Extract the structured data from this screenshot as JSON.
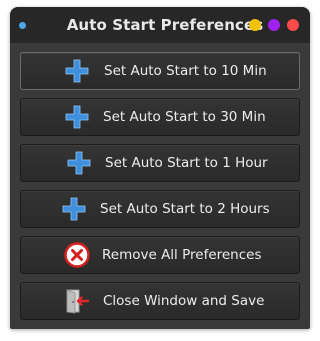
{
  "window": {
    "title": "Auto Start Preferences",
    "controls": {
      "minimize_color": "#f2c200",
      "maximize_color": "#a020f0",
      "close_color": "#ff4a4a"
    }
  },
  "buttons": [
    {
      "label": "Set Auto Start to 10 Min",
      "icon": "plus-icon"
    },
    {
      "label": "Set Auto Start to 30 Min",
      "icon": "plus-icon"
    },
    {
      "label": "Set Auto Start to 1 Hour",
      "icon": "plus-icon"
    },
    {
      "label": "Set Auto Start to 2 Hours",
      "icon": "plus-icon"
    },
    {
      "label": "Remove All Preferences",
      "icon": "remove-icon"
    },
    {
      "label": "Close Window and Save",
      "icon": "exit-door-icon"
    }
  ],
  "colors": {
    "plus": "#3f8fdc",
    "remove_ring": "#d62020",
    "titlebar_dot": "#4aa8e8"
  }
}
